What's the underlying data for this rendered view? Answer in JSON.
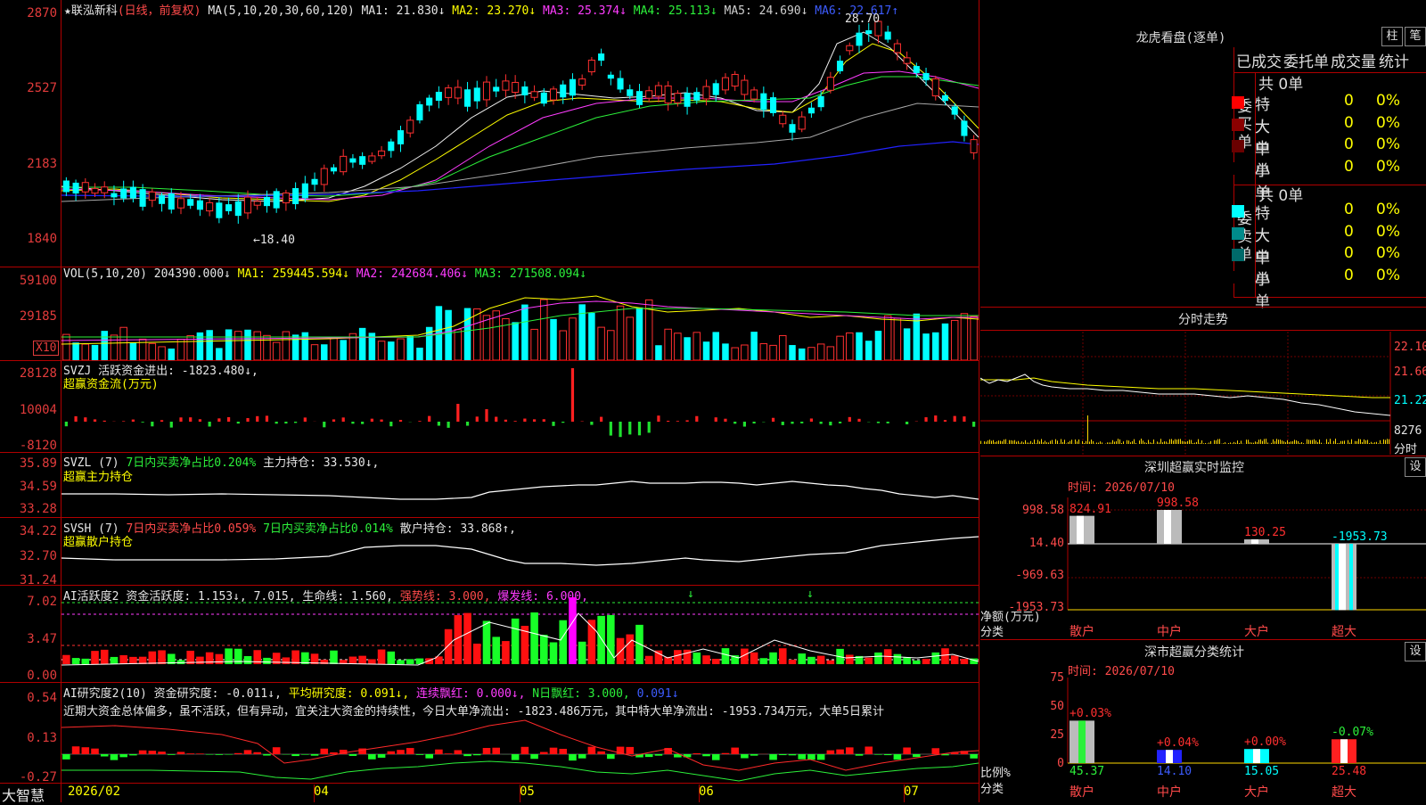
{
  "stock": {
    "title": "★联泓新科",
    "mode": "(日线，前复权)"
  },
  "ma_header": {
    "label": "MA(5,10,20,30,60,120)",
    "items": [
      {
        "text": "MA1: 21.830↓",
        "color": "#e6e6e6"
      },
      {
        "text": "MA2: 23.270↓",
        "color": "#ffff00"
      },
      {
        "text": "MA3: 25.374↓",
        "color": "#ff3cff"
      },
      {
        "text": "MA4: 25.113↓",
        "color": "#2cf03a"
      },
      {
        "text": "MA5: 24.690↓",
        "color": "#cfcfcf"
      },
      {
        "text": "MA6: 22.617↑",
        "color": "#3d5cff"
      }
    ]
  },
  "price_axis": [
    "2870",
    "2527",
    "2183",
    "1840"
  ],
  "price_annotations": {
    "high": "28.70",
    "low": "←18.40"
  },
  "vol": {
    "axis": [
      "59100",
      "29185"
    ],
    "unit": "X10",
    "header_label": "VOL(5,10,20)",
    "value": "204390.000↓",
    "ma1": "MA1: 259445.594↓",
    "ma2": "MA2: 242684.406↓",
    "ma3": "MA3: 271508.094↓"
  },
  "svzj": {
    "axis": [
      "28128",
      "10004",
      "-8120"
    ],
    "line1": "SVZJ  活跃资金进出: -1823.480↓,",
    "line2": "超赢资金流(万元)"
  },
  "svzl": {
    "axis": [
      "35.89",
      "34.59",
      "33.28"
    ],
    "label": "SVZL (7)",
    "t1": "7日内买卖净占比0.204%",
    "t2": "主力持仓: 33.530↓,",
    "line2": "超赢主力持仓"
  },
  "svsh": {
    "axis": [
      "34.22",
      "32.70",
      "31.24"
    ],
    "label": "SVSH (7)",
    "t1": "7日内买卖净占比0.059%",
    "t2": "7日内买卖净占比0.014%",
    "t3": "散户持仓: 33.868↑,",
    "line2": "超赢散户持仓"
  },
  "ai1": {
    "axis": [
      "7.02",
      "3.47",
      "0.00"
    ],
    "label": "AI活跃度2",
    "t1": "资金活跃度: 1.153↓,",
    "t2": "7.015,",
    "t3": "生命线: 1.560,",
    "t4": "强势线: 3.000,",
    "t5": "爆发线: 6.000,"
  },
  "ai2": {
    "axis": [
      "0.54",
      "0.13",
      "-0.27"
    ],
    "label": "AI研究度2(10)",
    "t1": "资金研究度: -0.011↓,",
    "t2": "平均研究度: 0.091↓,",
    "t3": "连续飘红: 0.000↓,",
    "t4": "N日飘红: 3.000,",
    "t5": "0.091↓",
    "commentary": "近期大资金总体偏多，虽不活跃，但有异动，宜关注大资金的持续性，今日大单净流出: -1823.486万元，其中特大单净流出: -1953.734万元，大单5日累计"
  },
  "xaxis": {
    "brand": "大智慧",
    "labels": [
      "2026/02",
      "04",
      "05",
      "06",
      "07"
    ]
  },
  "lhb": {
    "title": "龙虎看盘(逐单)",
    "btn_bar": "柱",
    "btn_pen": "笔",
    "tabs": [
      "已成交",
      "委托单",
      "成交量",
      "统计"
    ],
    "buy_label": "委买单",
    "sell_label": "委卖单",
    "buy_total": "共 0单",
    "sell_total": "共 0单",
    "buy_rows": [
      {
        "name": "特大",
        "count": "0",
        "pct": "0%",
        "color": "#ff0000"
      },
      {
        "name": "大单",
        "count": "0",
        "pct": "0%",
        "color": "#8b0000"
      },
      {
        "name": "中单",
        "count": "0",
        "pct": "0%",
        "color": "#6a0000"
      },
      {
        "name": "小单",
        "count": "0",
        "pct": "0%",
        "color": "#000000"
      }
    ],
    "sell_rows": [
      {
        "name": "特大",
        "count": "0",
        "pct": "0%",
        "color": "#00ffff"
      },
      {
        "name": "大单",
        "count": "0",
        "pct": "0%",
        "color": "#008b8b"
      },
      {
        "name": "中单",
        "count": "0",
        "pct": "0%",
        "color": "#006a6a"
      },
      {
        "name": "小单",
        "count": "0",
        "pct": "0%",
        "color": "#000000"
      }
    ]
  },
  "intraday": {
    "title": "分时走势",
    "axis": [
      "22.10",
      "21.66",
      "21.22"
    ],
    "vol_label": "8276",
    "foot": "分时"
  },
  "monitor": {
    "title": "深圳超赢实时监控",
    "btn": "设",
    "time": "时间: 2026/07/10",
    "axis": [
      "998.58",
      "14.40",
      "-969.63",
      "-1953.73"
    ],
    "ylabel": "净额(万元)",
    "xlabel": "分类",
    "bars": [
      {
        "cat": "散户",
        "value": "824.91"
      },
      {
        "cat": "中户",
        "value": "998.58"
      },
      {
        "cat": "大户",
        "value": "130.25"
      },
      {
        "cat": "超大",
        "value": "-1953.73"
      }
    ]
  },
  "classify": {
    "title": "深市超赢分类统计",
    "btn": "设",
    "time": "时间: 2026/07/10",
    "axis": [
      "75",
      "50",
      "25",
      "0"
    ],
    "ylabel": "比例%",
    "xlabel": "分类",
    "bars": [
      {
        "cat": "散户",
        "pct": "45.37",
        "chg": "+0.03%"
      },
      {
        "cat": "中户",
        "pct": "14.10",
        "chg": "+0.04%"
      },
      {
        "cat": "大户",
        "pct": "15.05",
        "chg": "+0.00%"
      },
      {
        "cat": "超大",
        "pct": "25.48",
        "chg": "-0.07%"
      }
    ]
  }
}
